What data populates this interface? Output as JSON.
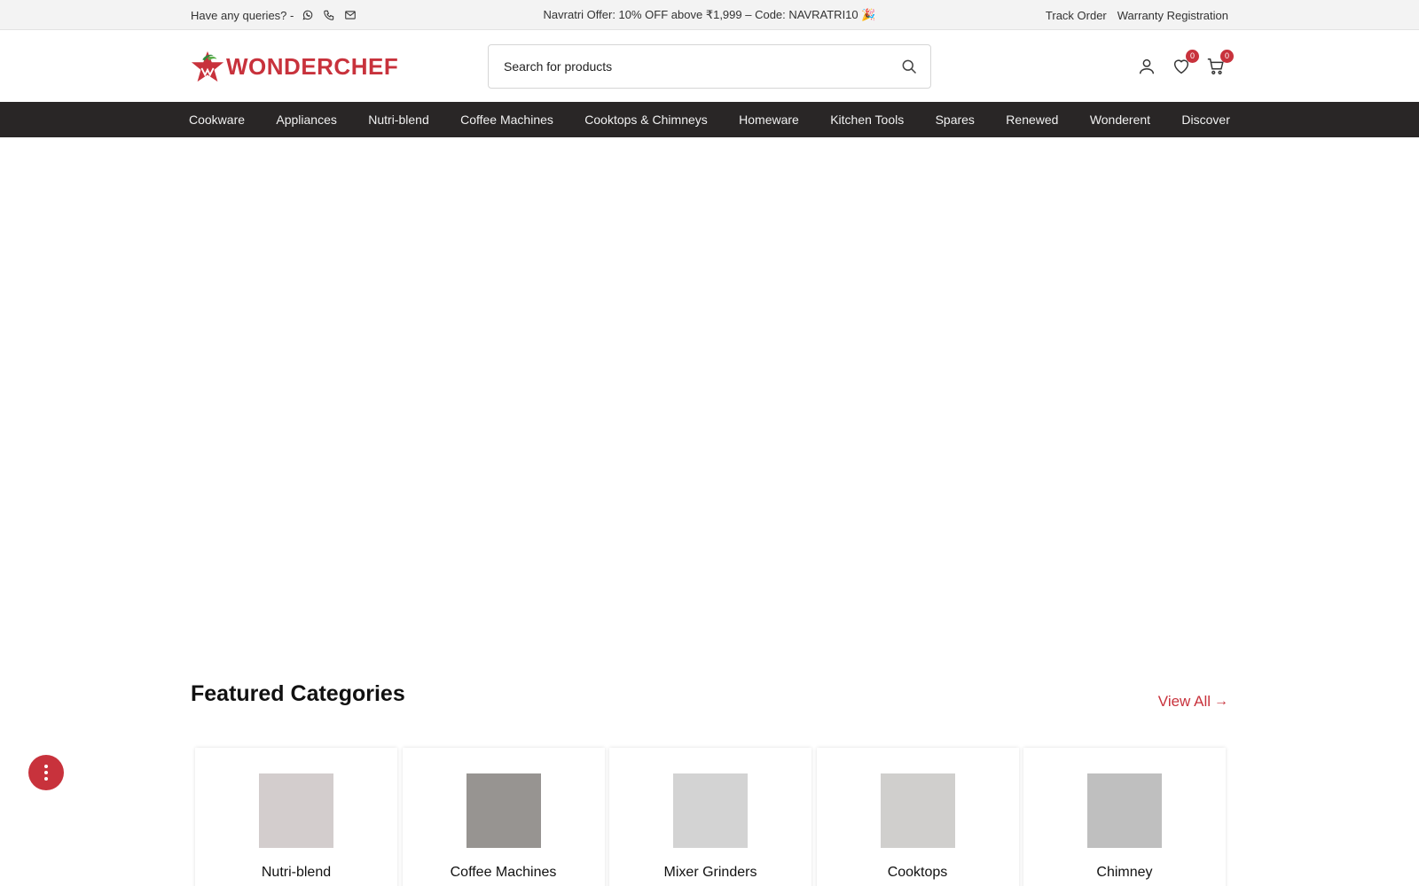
{
  "topbar": {
    "queries_label": "Have any queries? -",
    "contact_icons": [
      "whatsapp-icon",
      "phone-icon",
      "mail-icon"
    ],
    "offer_text": "Navratri Offer: 10% OFF above ₹1,999 – Code: NAVRATRI10 🎉",
    "links": [
      "Track Order",
      "Warranty Registration"
    ]
  },
  "header": {
    "logo_text": "WONDERCHEF",
    "search_placeholder": "Search for products",
    "wishlist_count": "0",
    "cart_count": "0"
  },
  "nav": {
    "items": [
      "Cookware",
      "Appliances",
      "Nutri-blend",
      "Coffee Machines",
      "Cooktops & Chimneys",
      "Homeware",
      "Kitchen Tools",
      "Spares",
      "Renewed",
      "Wonderent",
      "Discover"
    ]
  },
  "featured": {
    "title": "Featured Categories",
    "view_all": "View All",
    "categories": [
      {
        "name": "Nutri-blend",
        "color": "#d3cdcd"
      },
      {
        "name": "Coffee Machines",
        "color": "#979491"
      },
      {
        "name": "Mixer Grinders",
        "color": "#d3d3d3"
      },
      {
        "name": "Cooktops",
        "color": "#d0cfcd"
      },
      {
        "name": "Chimney",
        "color": "#bfbfbf"
      }
    ]
  },
  "colors": {
    "brand": "#c8323c",
    "nav_bg": "#292626",
    "topbar_bg": "#f3f3f3"
  }
}
